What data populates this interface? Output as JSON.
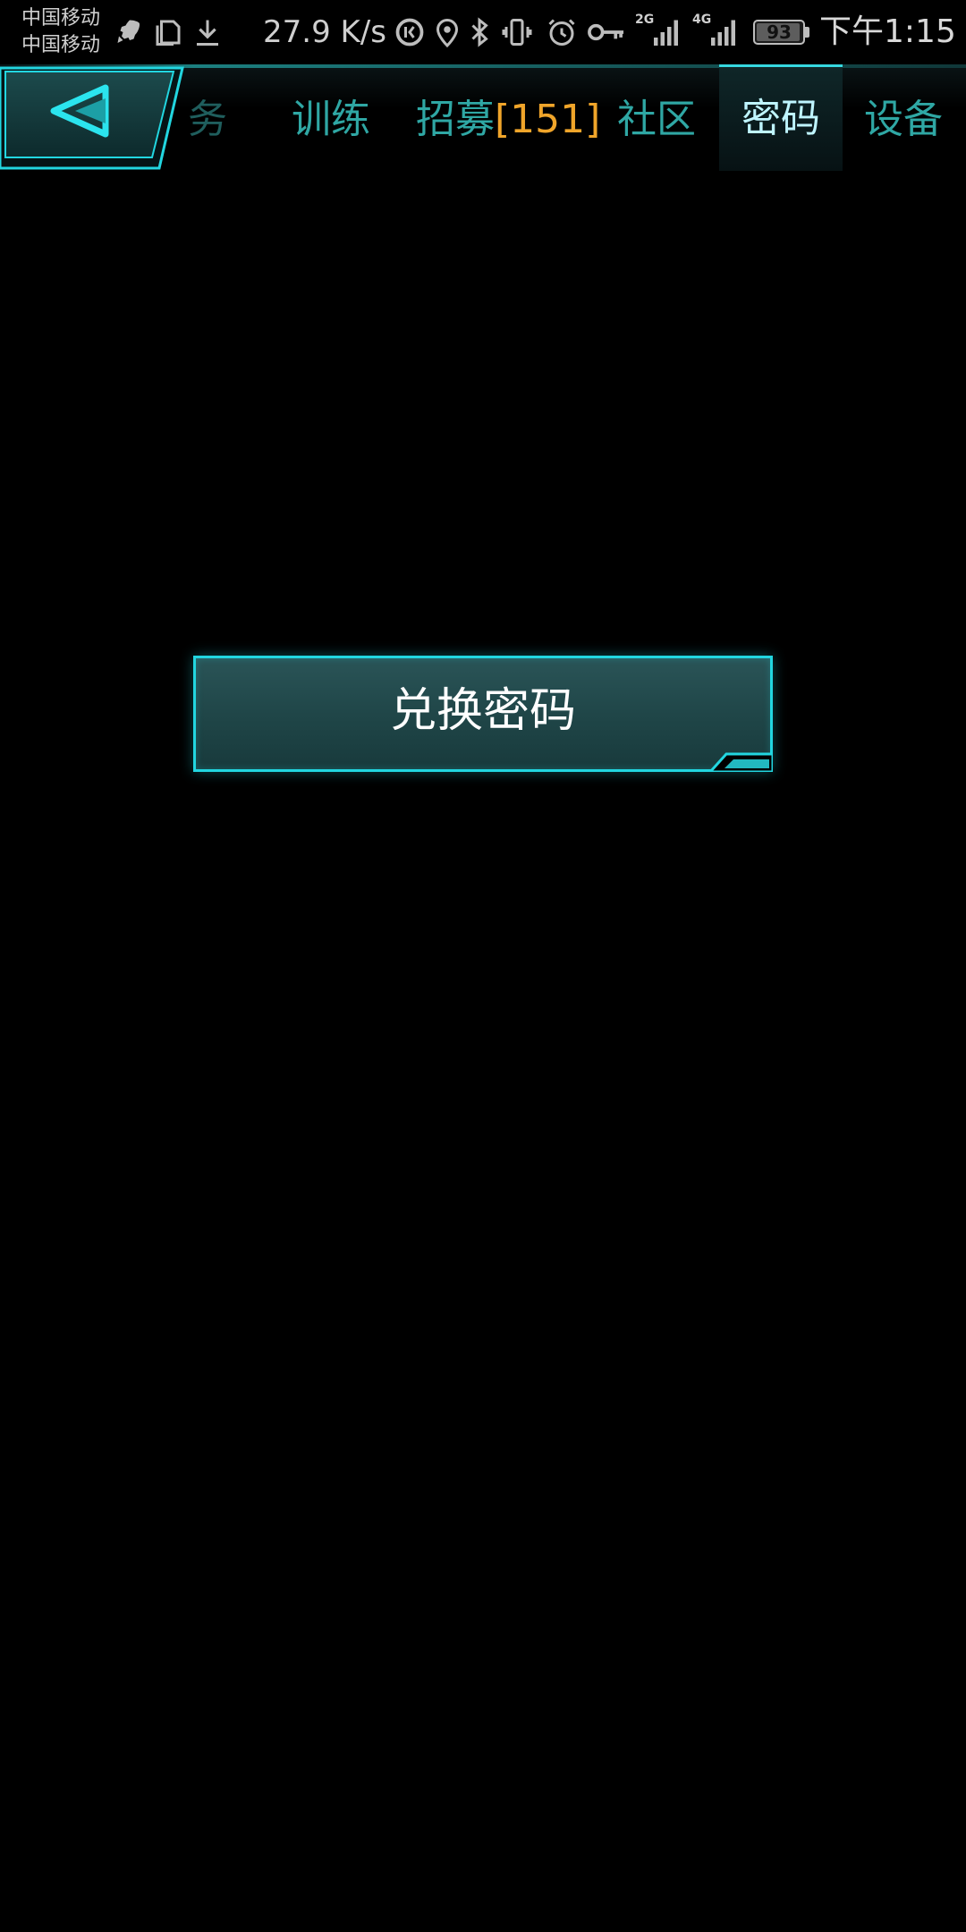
{
  "status_bar": {
    "carriers": [
      "中国移动",
      "中国移动"
    ],
    "net_speed": "27.9 K/s",
    "signal_tags": [
      "2G",
      "4G"
    ],
    "battery": "93",
    "time": "下午1:15",
    "icons": [
      "rocket-icon",
      "document-icon",
      "download-icon",
      "data-saver-icon",
      "location-icon",
      "bluetooth-icon",
      "vibrate-icon",
      "alarm-icon",
      "key-icon",
      "signal-2g-icon",
      "signal-4g-icon",
      "battery-icon"
    ]
  },
  "nav": {
    "back_icon": "back-triangle-icon",
    "tabs": [
      {
        "label": "务"
      },
      {
        "label": "训练"
      },
      {
        "label": "招募",
        "count": "[151]"
      },
      {
        "label": "社区"
      },
      {
        "label": "密码"
      },
      {
        "label": "设备"
      }
    ],
    "active_tab": "密码"
  },
  "main": {
    "redeem_button": "兑换密码"
  },
  "colors": {
    "accent": "#22d6e0",
    "tab_text": "#2fa7a4",
    "count": "#f0a52a",
    "button_fill": "#234a4c"
  }
}
